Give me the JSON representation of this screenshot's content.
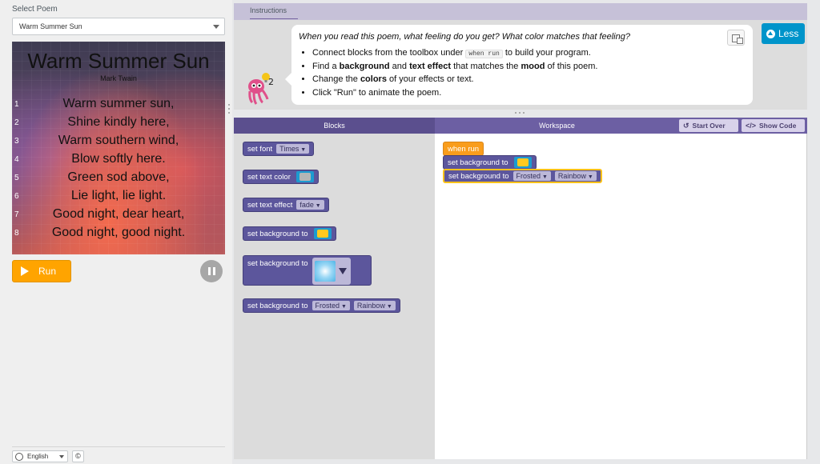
{
  "left_panel": {
    "select_label": "Select Poem",
    "poem_select_value": "Warm Summer Sun",
    "poem": {
      "title": "Warm Summer Sun",
      "author": "Mark Twain",
      "lines": [
        {
          "num": "1",
          "text": "Warm summer sun,"
        },
        {
          "num": "2",
          "text": "Shine kindly here,"
        },
        {
          "num": "3",
          "text": "Warm southern wind,"
        },
        {
          "num": "4",
          "text": "Blow softly here."
        },
        {
          "num": "5",
          "text": "Green sod above,"
        },
        {
          "num": "6",
          "text": "Lie light, lie light."
        },
        {
          "num": "7",
          "text": "Good night, dear heart,"
        },
        {
          "num": "8",
          "text": "Good night, good night."
        }
      ]
    },
    "run_label": "Run",
    "language": "English",
    "copyright_symbol": "©"
  },
  "instructions": {
    "tab_label": "Instructions",
    "bot_badge": "2",
    "question": "When you read this poem, what feeling do you get? What color matches that feeling?",
    "items": [
      {
        "pre": "Connect blocks from the toolbox under ",
        "code": "when run",
        "post": " to build your program."
      },
      {
        "pre": "Find a ",
        "b1": "background",
        "mid": " and ",
        "b2": "text effect",
        "mid2": " that matches the ",
        "b3": "mood",
        "post": " of this poem."
      },
      {
        "pre": "Change the ",
        "b1": "colors",
        "post": " of your effects or text."
      },
      {
        "text": "Click \"Run\" to animate the poem."
      }
    ],
    "less_label": "Less"
  },
  "editor": {
    "blocks_header": "Blocks",
    "workspace_header": "Workspace",
    "start_over_label": "Start Over",
    "show_code_label": "Show Code",
    "toolbox": {
      "set_font": "set font",
      "font_value": "Times",
      "set_text_color": "set text color",
      "set_text_effect": "set text effect",
      "effect_value": "fade",
      "set_background_color": "set background to",
      "set_background_image": "set background to",
      "set_background_effect": "set background to",
      "bg_effect_value": "Frosted",
      "bg_palette_value": "Rainbow"
    },
    "workspace": {
      "when_run": "when run",
      "set_background_color": "set background to",
      "set_background_effect": "set background to",
      "bg_effect_value": "Frosted",
      "bg_palette_value": "Rainbow"
    }
  },
  "colors": {
    "run_button": "#ffa400",
    "less_button": "#0094ca",
    "block_purple": "#5c569c",
    "event_orange": "#f99d1c",
    "color_swatch_yellow": "#ffc91f",
    "color_swatch_gray": "#b5b5b5"
  }
}
